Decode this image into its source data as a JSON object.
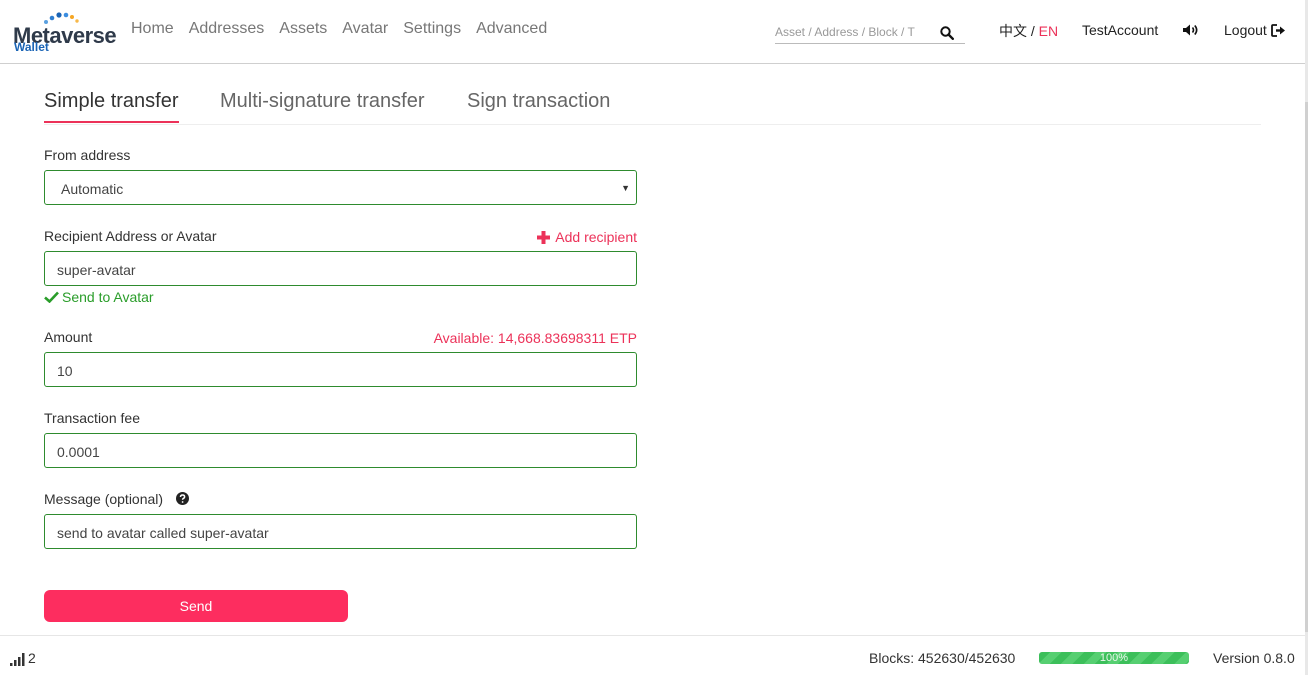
{
  "header": {
    "logo_title": "Metaverse",
    "logo_subtitle": "Wallet",
    "nav": [
      "Home",
      "Addresses",
      "Assets",
      "Avatar",
      "Settings",
      "Advanced"
    ],
    "search_placeholder": "Asset / Address / Block / T",
    "lang_cn": "中文",
    "lang_separator": " / ",
    "lang_en": "EN",
    "account": "TestAccount",
    "logout": "Logout"
  },
  "tabs": [
    "Simple transfer",
    "Multi-signature transfer",
    "Sign transaction"
  ],
  "active_tab": "Simple transfer",
  "form": {
    "from_label": "From address",
    "from_value": "Automatic",
    "recipient_label": "Recipient Address or Avatar",
    "add_recipient": "Add recipient",
    "recipient_value": "super-avatar",
    "recipient_status": "Send to Avatar",
    "amount_label": "Amount",
    "available": "Available: 14,668.83698311 ETP",
    "amount_value": "10",
    "fee_label": "Transaction fee",
    "fee_value": "0.0001",
    "message_label": "Message (optional)",
    "message_value": "send to avatar called super-avatar",
    "send": "Send"
  },
  "footer": {
    "peers": "2",
    "blocks": "Blocks: 452630/452630",
    "sync_progress": 1.0,
    "sync_label": "100%",
    "version": "Version 0.8.0"
  },
  "colors": {
    "accent": "#ec3259",
    "button": "#fd2d5f",
    "valid": "#2a9d2a",
    "field_border": "#2e8b2e",
    "progress": "#3cbf5a"
  }
}
